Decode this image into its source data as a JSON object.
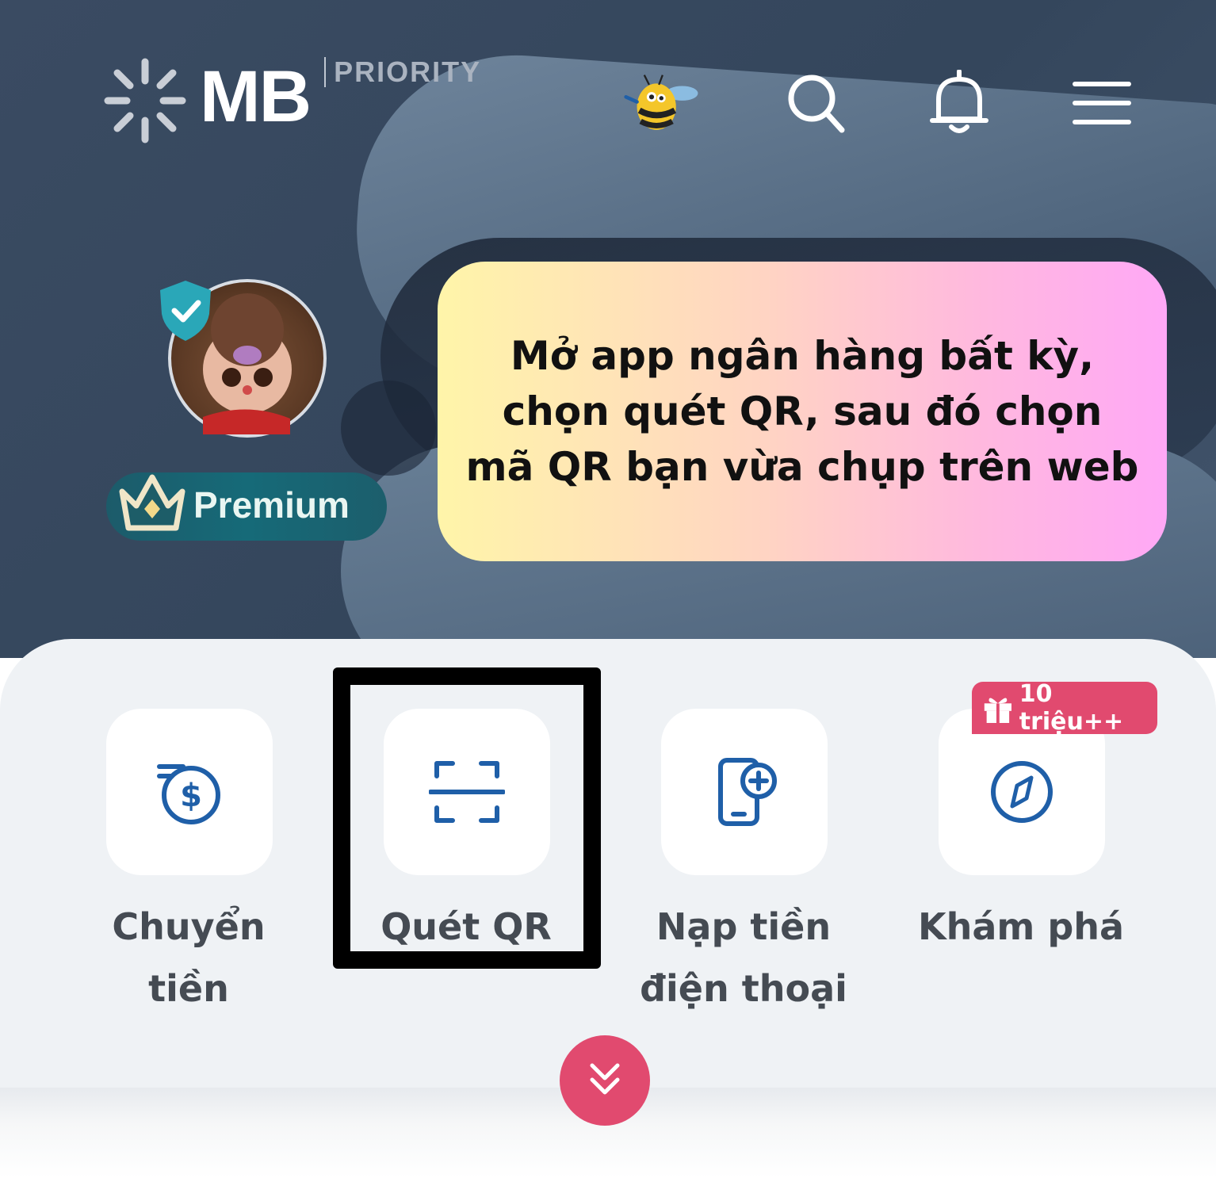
{
  "header": {
    "brand": "MB",
    "brand_tier": "PRIORITY",
    "icons": [
      "bee-mascot-icon",
      "search-icon",
      "bell-icon",
      "menu-icon"
    ]
  },
  "profile": {
    "badge_label": "Premium"
  },
  "callout": {
    "text": "Mở app ngân hàng bất kỳ,\nchọn quét QR, sau đó chọn\nmã QR bạn vừa chụp trên web"
  },
  "quick_actions": [
    {
      "label": "Chuyển\ntiền",
      "icon": "money-transfer-icon"
    },
    {
      "label": "Quét QR",
      "icon": "qr-scan-icon"
    },
    {
      "label": "Nạp tiền\nđiện thoại",
      "icon": "phone-topup-icon"
    },
    {
      "label": "Khám phá",
      "icon": "compass-icon"
    }
  ],
  "promo_badge": {
    "text": "10 triệu++",
    "icon": "gift-icon"
  },
  "colors": {
    "accent": "#e14a6f",
    "icon_blue": "#1f5fa8",
    "hero_bg": "#3a4b62",
    "panel_bg": "#eff2f5"
  }
}
